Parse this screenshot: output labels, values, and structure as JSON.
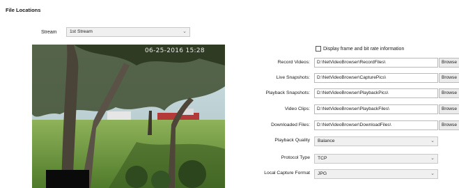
{
  "section_title": "File Locations",
  "stream": {
    "label": "Stream",
    "value": "1st Stream"
  },
  "preview": {
    "timestamp": "06-25-2016 15:28"
  },
  "display_info": {
    "label": "Display frame and bit rate information",
    "checked": false
  },
  "paths": [
    {
      "label": "Record Videos:",
      "value": "D:\\NetVideoBrowser\\RecordFiles\\",
      "button": "Browse"
    },
    {
      "label": "Live Snapshots:",
      "value": "D:\\NetVideoBrowser\\CapturePics\\",
      "button": "Browse"
    },
    {
      "label": "Playback Snapshots:",
      "value": "D:\\NetVideoBrowser\\PlaybackPics\\",
      "button": "Browse"
    },
    {
      "label": "Video Clips:",
      "value": "D:\\NetVideoBrowser\\PlaybackFiles\\",
      "button": "Browse"
    },
    {
      "label": "Downloaded Files:",
      "value": "D:\\NetVideoBrowser\\DownloadFiles\\",
      "button": "Browse"
    }
  ],
  "options": [
    {
      "label": "Playback Quality",
      "value": "Balance"
    },
    {
      "label": "Protocol Type",
      "value": "TCP"
    },
    {
      "label": "Local Capture Format",
      "value": "JPG"
    }
  ]
}
